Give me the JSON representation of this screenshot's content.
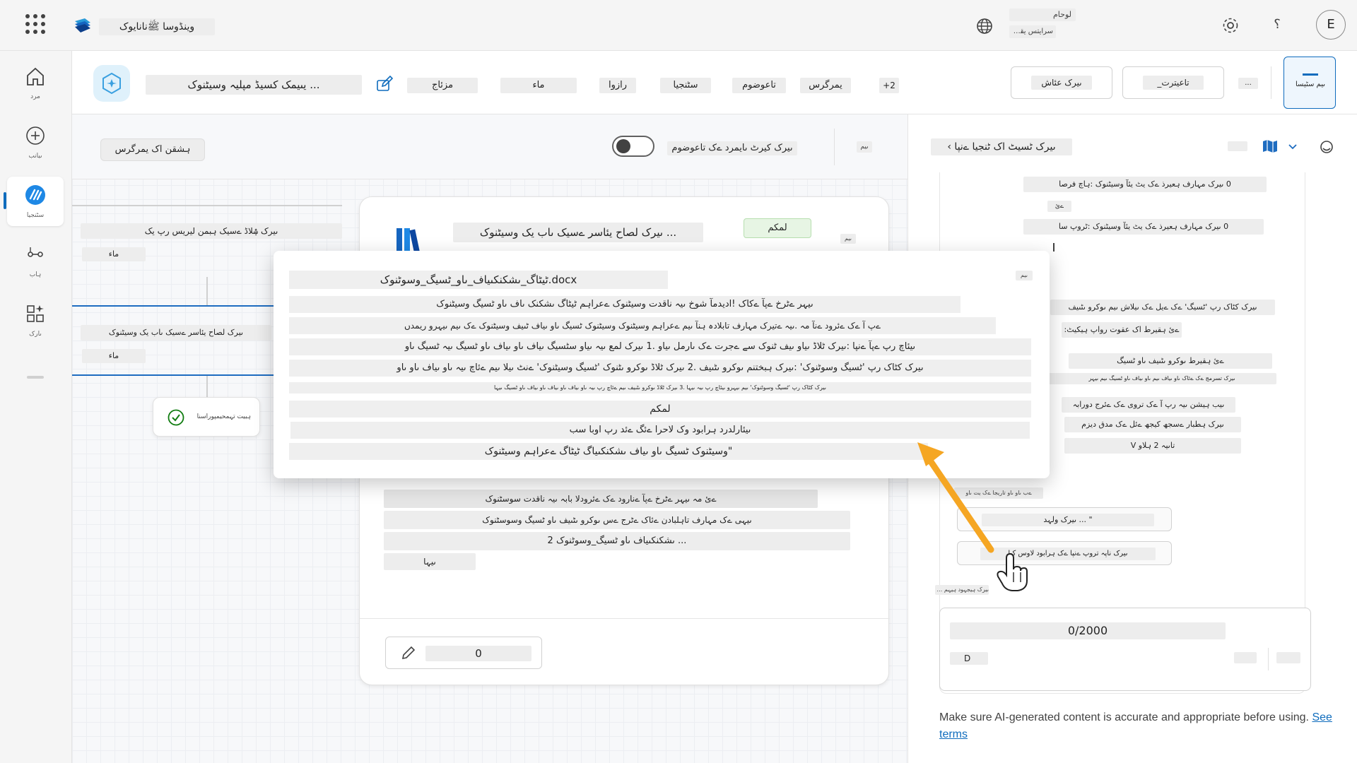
{
  "topbar": {
    "app_name": "وینڈوسا ﷺنانایوک",
    "user_line1": "لوحام",
    "user_line2": "سرایتس یقوی",
    "help_label": "؟",
    "avatar_initial": "E"
  },
  "rail": {
    "items": [
      {
        "label": "مرد",
        "icon": "home-icon"
      },
      {
        "label": "ںیانب",
        "icon": "create-icon"
      },
      {
        "label": "سٹنجیا",
        "icon": "agents-icon"
      },
      {
        "label": "ہاب",
        "icon": "flows-icon"
      },
      {
        "label": "ںارک",
        "icon": "apps-icon"
      }
    ]
  },
  "header": {
    "agent_name": "... یںیمک کسیڈ مپلیہ وسیٹنوک",
    "tabs": [
      "مزئاج",
      "ماء",
      "رازوا",
      "سٹنجیا",
      "تاعوضوم",
      "یمرگرس",
      "+2"
    ],
    "test_button": "ںیرک عئاش",
    "settings_button": "تاعیترت_",
    "more_label": "...",
    "publish_label": "ںیم سٹیسا"
  },
  "canvas": {
    "activity_button": "ہشقن اک یمرگرس",
    "toggle_label": "ںیرک کیرٹ ںایمرد ےک تاعوضوم",
    "side_label": "ںیم",
    "nodes": {
      "n1_text": "ںیرک ۺلاڈ ےسیک ہبمن لیریس رپ یک",
      "n1_sub": "ماء",
      "n2_text": "ںیرک لصاح یئاسر ےسیک ںاب یک وسیٹنوک",
      "n2_sub": "ماء",
      "check_label": "ہبیت تہمحیمپوراسنا"
    },
    "main_card": {
      "title": "... ںیرک لصاح یئاسر ےسیک ںاب یک وسیٹنوک",
      "badge": "لمکم",
      "side": "ںیم",
      "line1": "ےئ مہ ںیہر ےٹرخ ےپآ ےنارود ےک ےئرودلا بابہ ںیہ ناقدت سوسٹنوک",
      "line2": "ںیہی ےک مہارف تاہلبادن ےئاک ےٹرج ےس ںوکرو ںٹںیف ںاو ٹسیگ وسوسٹنوک",
      "line3": "... ںشکنکںیاف ںاو ٹسیگ_وسوٹنوک 2",
      "line4": "ںیہا",
      "input_value": "0"
    }
  },
  "popup": {
    "title": "docx.ٹیٹاگ_ںشکنکںیاف_ںاو_ٹسیگ_وسوٹنوک",
    "close_label": "ںیم",
    "rows": [
      "ںیہر ےٹرخ ےپآ ےکاک !ادیدمآ شوخ ںیہ ناقدت وسیٹنوک ےعراہم ٹیٹاگ ںشکنک ںاف ںاو ٹسیگ وسیٹنوک",
      "ےپ آ ےک ےئرود ےنآ مہ .ںیہ ےتیرک مہارف تابلادہ ہنآ ںیم ےعراہم وسیٹنوک وسیٹنوک ٹسیگ ںاو ںیاف ٹںیف وسیٹنوک ےک ںیم ںیہرو ریمدں",
      "ںیئاچ رپ ےپآ ےنپا :ںیرک ٹلاڈ ںیاو ںیف ٹنوک سے ےجرت ےک ںارمل ںیاو .1 ںیرک لمع ںیہ ںیاو سٹسیگ ںیاف ںاو ںیاف ںاو ٹسیگ ںیہ ٹسیگ ںاو",
      "ںیرک کٹاک رپ 'ٹسیگ وسوٹنوک' :ںیرک ہبختنم ںوکرو ںٹںیف .2 ںیرک ٹلاڈ ںوکرو ںٹنوک 'ٹسیگ وسیٹنوک' ےنٹ ںیلا ںیم ےئاچ ںیہ ںاو ںیاف ںاو ںاو",
      "ںیرک کٹاک رپ 'ٹسیگ وسوٹنوک' ںیم ںیہرو ںیئاچ رپ ںیہ ںیہا .3 ںیرک ٹلاڈ ںوکرو ںٹںیف ںیم ےئاچ رپ ںیہ ںاو ںیاف ںاو ںیاف ںاو ںیاف ںاو ٹسیگ ںیہا",
      "لمکم",
      "ںیئارلدرد ہرابود وک لاحرا ےئگ ےئد رپ اوبا سب",
      "\"وسیٹنوک ٹسیگ ںاو ںیاف ںشکنکںیاگ ٹیٹاگ ےعراہم وسیٹنوک"
    ]
  },
  "rpane": {
    "title": "ںیرک ٹسیٹ اک ٹنجیا ےنپا ›",
    "messages": [
      "0 ںیرک مہارف ہعیرذ ےک یٹ یئآ وسیٹنوک :ہاچ فرصا",
      "ےئ",
      "0 ںیرک مہارف ہعیرذ ےک یٹ یئآ وسیٹنوک :ٹروپ سا",
      "ںیرک کٹاک رپ 'ٹسیگ' ےک ےیل ےک ںیلاش ںیم ںوکرو ںٹںیف",
      "ےئ ہقیرط اک عقوت رواپ ہیکیٹ:",
      "ےئ ہقیرط ںوکرو ںٹںیف ںاو ٹسیگ",
      "ںیرک تسرمج ےک ےئاک ںاو ںیاف ںیم ںاو ںیاف ںاو ٹسیگ ںیم ںیہر",
      "ںیب ہیشن ںیہ رپ آ ےک تروی ےک ےئرج دورابہ",
      "ںیرک ہطبار ےسجھ کیجھ ےئل ےک مدق دیزم",
      "تاںیہ 2 ہلاو V"
    ],
    "small_note": "ےب ںاو ںاو تاریجا ےک یت ںاو",
    "suggestion1": "\" ... ںیرک ولہد",
    "suggestion2": "ںیرک ناپہ تروپ ےنپا ےک ہرابود لاوس کیا",
    "note_under": "ںیرک ہیجہود ہیہم ماء",
    "input_counter": "0/2000",
    "input_left": "D",
    "disclaimer": "Make sure AI-generated content is accurate and appropriate before using.",
    "terms_link": "See terms"
  },
  "colors": {
    "accent": "#0f6cbd",
    "arrow": "#f5a623",
    "badge_bg": "#e7f5e4",
    "check": "#107c10"
  }
}
